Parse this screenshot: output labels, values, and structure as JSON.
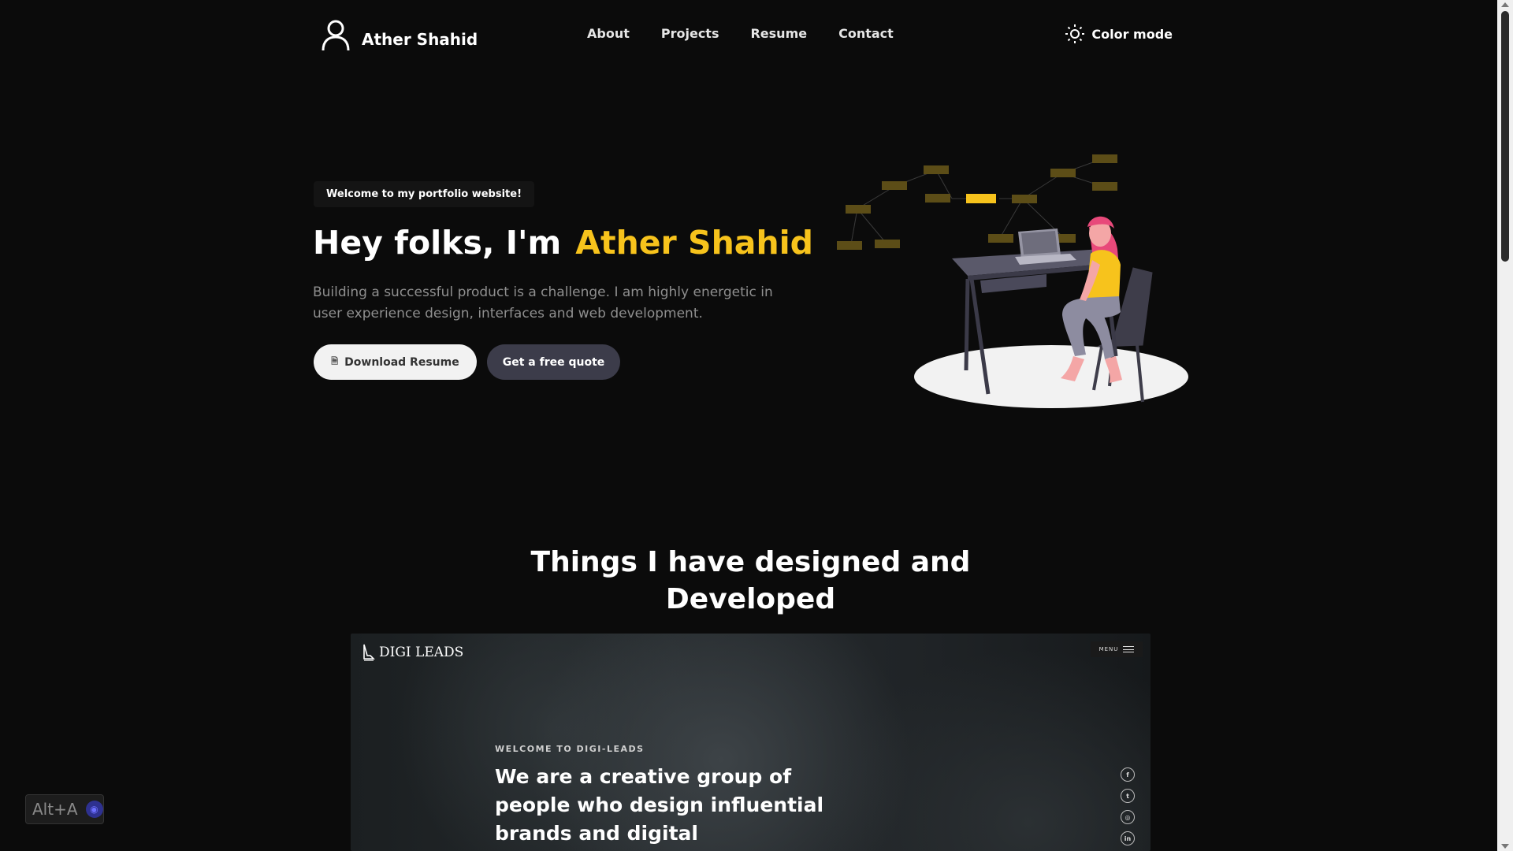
{
  "nav": {
    "brand_name": "Ather Shahid",
    "links": [
      "About",
      "Projects",
      "Resume",
      "Contact"
    ],
    "color_mode_label": "Color mode"
  },
  "hero": {
    "badge": "Welcome to my portfolio website!",
    "title_prefix": "Hey folks, I'm",
    "title_name": "Ather Shahid",
    "description": "Building a successful product is a challenge. I am highly energetic in user experience design, interfaces and web development.",
    "download_button": "Download Resume",
    "quote_button": "Get a free quote"
  },
  "projects": {
    "section_title": "Things I have designed and Developed",
    "card": {
      "logo_text": "DIGI LEADS",
      "menu_label": "MENU",
      "kicker": "WELCOME TO DIGI-LEADS",
      "headline": "We are a creative group of people who design influential brands and digital experiences.",
      "social_icons": [
        "facebook-icon",
        "twitter-icon",
        "instagram-icon",
        "linkedin-icon"
      ],
      "social_glyphs": [
        "f",
        "t",
        "◎",
        "in"
      ]
    }
  },
  "widget": {
    "label": "Alt+A"
  },
  "colors": {
    "background": "#0b0b0b",
    "accent": "#f7c31c",
    "secondary_button": "#3c3c4a"
  }
}
